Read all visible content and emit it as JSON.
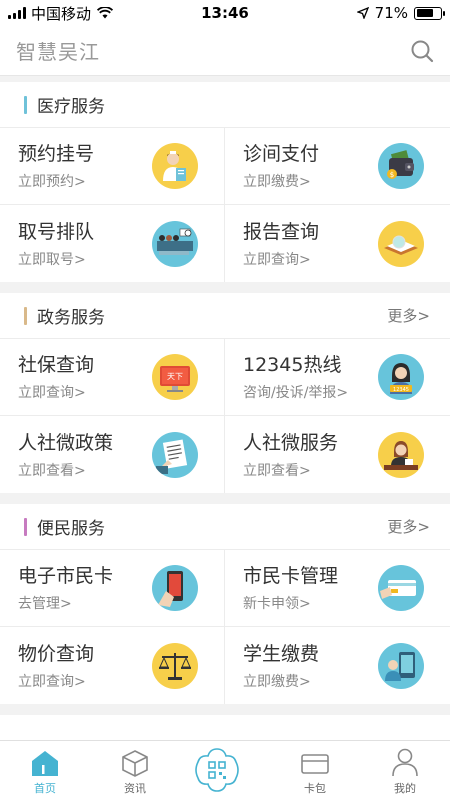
{
  "status_bar": {
    "carrier": "中国移动",
    "time": "13:46",
    "battery": "71%",
    "battery_level": 0.71
  },
  "header": {
    "title": "智慧吴江"
  },
  "sections": [
    {
      "title": "医疗服务",
      "accent": "#6fc2d9",
      "more": "",
      "items": [
        {
          "title": "预约挂号",
          "sub": "立即预约>",
          "icon": "nurse-icon"
        },
        {
          "title": "诊间支付",
          "sub": "立即缴费>",
          "icon": "wallet-icon"
        },
        {
          "title": "取号排队",
          "sub": "立即取号>",
          "icon": "queue-icon"
        },
        {
          "title": "报告查询",
          "sub": "立即查询>",
          "icon": "report-icon"
        }
      ]
    },
    {
      "title": "政务服务",
      "accent": "#d9b98a",
      "more": "更多>",
      "items": [
        {
          "title": "社保查询",
          "sub": "立即查询>",
          "icon": "social-security-icon"
        },
        {
          "title": "12345热线",
          "sub": "咨询/投诉/举报>",
          "icon": "hotline-icon"
        },
        {
          "title": "人社微政策",
          "sub": "立即查看>",
          "icon": "policy-document-icon"
        },
        {
          "title": "人社微服务",
          "sub": "立即查看>",
          "icon": "service-agent-icon"
        }
      ]
    },
    {
      "title": "便民服务",
      "accent": "#c77bc0",
      "more": "更多>",
      "items": [
        {
          "title": "电子市民卡",
          "sub": "去管理>",
          "icon": "mobile-card-icon"
        },
        {
          "title": "市民卡管理",
          "sub": "新卡申领>",
          "icon": "card-manage-icon"
        },
        {
          "title": "物价查询",
          "sub": "立即查询>",
          "icon": "scale-icon"
        },
        {
          "title": "学生缴费",
          "sub": "立即缴费>",
          "icon": "student-pay-icon"
        }
      ]
    }
  ],
  "hotline_badge": "12345",
  "social_badge": "天下",
  "tabbar": {
    "home": "首页",
    "news": "资讯",
    "wallet": "卡包",
    "mine": "我的"
  },
  "colors": {
    "accent": "#45b3d1",
    "icon_teal": "#67c4db",
    "icon_yellow": "#f7cf4a"
  }
}
